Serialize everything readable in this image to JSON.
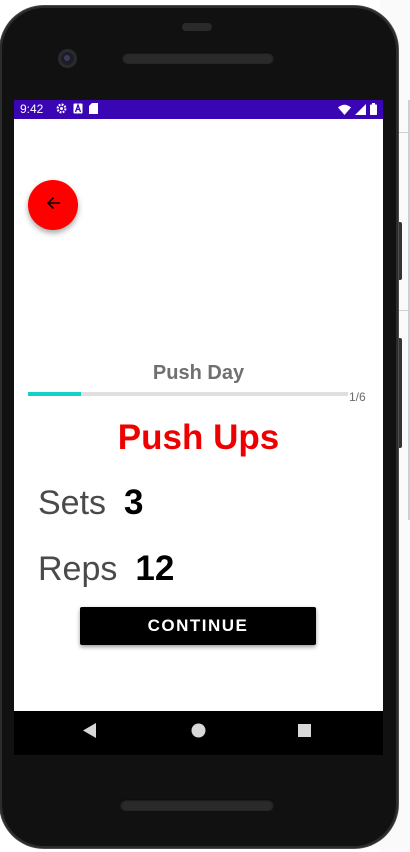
{
  "status_bar": {
    "time": "9:42",
    "left_icons": [
      "gear-icon",
      "a-icon",
      "sd-card-icon"
    ],
    "right_icons": [
      "wifi-icon",
      "signal-icon",
      "battery-icon"
    ],
    "background_color": "#3a06b3"
  },
  "back_button": {
    "icon": "arrow-left-icon",
    "color": "#ff0000"
  },
  "workout": {
    "title": "Push Day",
    "progress_text": "1/6",
    "progress_fraction": 0.1667,
    "progress_color": "#13d0c8"
  },
  "exercise": {
    "name": "Push Ups",
    "name_color": "#ee0000",
    "sets_label": "Sets",
    "sets_value": "3",
    "reps_label": "Reps",
    "reps_value": "12"
  },
  "continue_button": {
    "label": "CONTINUE"
  },
  "nav_bar": {
    "buttons": [
      "back-triangle-icon",
      "home-circle-icon",
      "recents-square-icon"
    ]
  }
}
